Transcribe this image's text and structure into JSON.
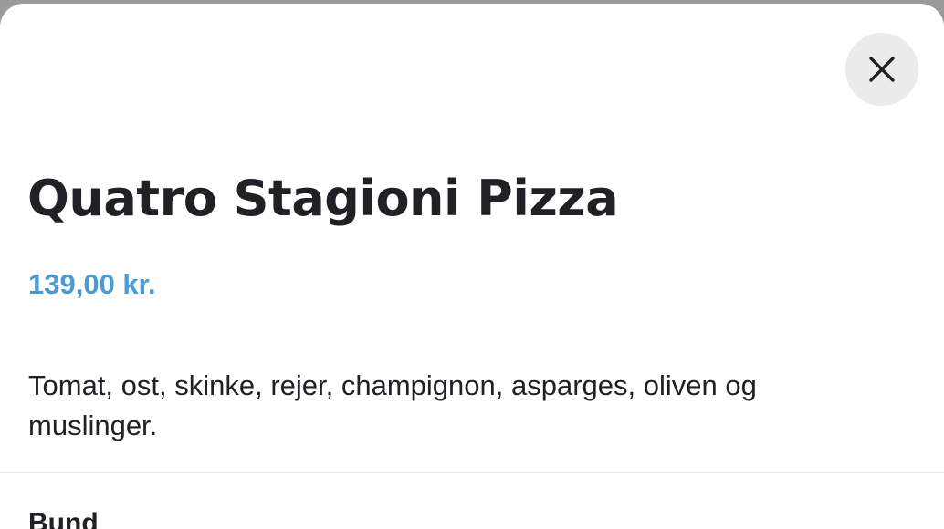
{
  "product": {
    "title": "Quatro Stagioni Pizza",
    "price": "139,00 kr.",
    "description": "Tomat, ost, skinke, rejer, champignon, asparges, oliven og muslinger."
  },
  "options": {
    "section_label": "Bund"
  },
  "controls": {
    "close_icon": "close-icon"
  },
  "colors": {
    "accent": "#4a9bd1",
    "text": "#202125",
    "close_bg": "#ebebeb"
  }
}
